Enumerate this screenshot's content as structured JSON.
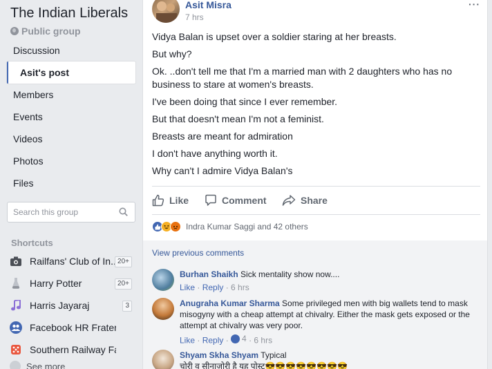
{
  "group": {
    "title": "The Indian Liberals",
    "type": "Public group"
  },
  "nav": [
    {
      "label": "Discussion"
    },
    {
      "label": "Asit's post"
    },
    {
      "label": "Members"
    },
    {
      "label": "Events"
    },
    {
      "label": "Videos"
    },
    {
      "label": "Photos"
    },
    {
      "label": "Files"
    }
  ],
  "search": {
    "placeholder": "Search this group"
  },
  "shortcuts": {
    "title": "Shortcuts",
    "items": [
      {
        "label": "Railfans' Club of In...",
        "badge": "20+",
        "icon": "camera-icon"
      },
      {
        "label": "Harry Potter",
        "badge": "20+",
        "icon": "potion-icon"
      },
      {
        "label": "Harris Jayaraj",
        "badge": "3",
        "icon": "music-note-icon"
      },
      {
        "label": "Facebook HR Fraternity",
        "badge": "",
        "icon": "group-icon"
      },
      {
        "label": "Southern Railway Fans ©",
        "badge": "",
        "icon": "dice-icon"
      }
    ],
    "see_more": "See more"
  },
  "post": {
    "author": "Asit Misra",
    "time": "7 hrs",
    "more": "···",
    "lines": [
      "Vidya Balan is upset over a soldier staring at her breasts.",
      "But why?",
      "Ok. ..don't tell me that I'm a married man with 2 daughters who has no business to stare at women's breasts.",
      "I've been doing that since I ever remember.",
      "But that doesn't mean I'm not a feminist.",
      "Breasts are meant for admiration",
      "I don't have anything worth it.",
      "Why can't I admire Vidya Balan's"
    ],
    "actions": {
      "like": "Like",
      "comment": "Comment",
      "share": "Share"
    },
    "reactions_text": "Indra Kumar Saggi and 42 others"
  },
  "comments": {
    "view_previous": "View previous comments",
    "items": [
      {
        "name": "Burhan Shaikh",
        "text": "Sick mentality show now....",
        "like": "Like",
        "reply": "Reply",
        "time": "6 hrs",
        "react_count": ""
      },
      {
        "name": "Anugraha Kumar Sharma",
        "text": "Some privileged men with big wallets tend to mask misogyny with a cheap attempt at chivalry. Either the mask gets exposed or the attempt at chivalry was very poor.",
        "like": "Like",
        "reply": "Reply",
        "time": "6 hrs",
        "react_count": "4"
      },
      {
        "name": "Shyam Skha Shyam",
        "text": "Typical",
        "text2": "चोरी व सीनाजोरी है यह पोस्ट😎😎😎😎😎😎😎😎"
      }
    ]
  },
  "colors": {
    "link": "#365899",
    "accent": "#4267b2",
    "background": "#e9ebee"
  }
}
